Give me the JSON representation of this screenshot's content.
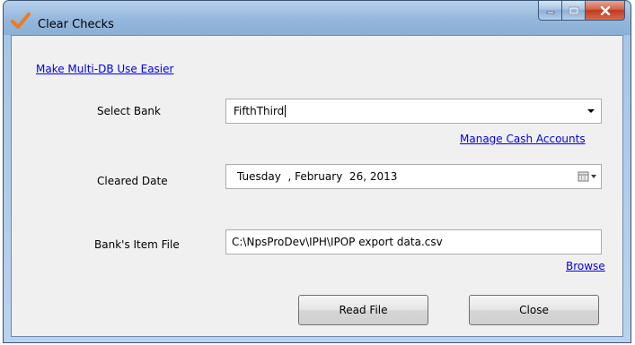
{
  "window": {
    "title": "Clear Checks",
    "buttons": {
      "minimize": "minimize",
      "maximize": "maximize",
      "close": "close"
    }
  },
  "links": {
    "multi_db": "Make Multi-DB Use Easier",
    "manage_cash": "Manage Cash Accounts",
    "browse": "Browse"
  },
  "form": {
    "bank": {
      "label": "Select Bank",
      "value": "FifthThird"
    },
    "cleared_date": {
      "label": "Cleared Date",
      "weekday": "Tuesday",
      "separator": ",",
      "date": "February  26, 2013"
    },
    "item_file": {
      "label": "Bank's Item  File",
      "value": "C:\\NpsProDev\\IPH\\IPOP export data.csv"
    }
  },
  "actions": {
    "read_file": "Read File",
    "close": "Close"
  },
  "icons": {
    "app": "checkmark-icon",
    "dropdown": "chevron-down-icon",
    "calendar": "calendar-icon"
  },
  "colors": {
    "link": "#0000ee",
    "title_bar": "#95b7dc",
    "close_button": "#c13a1f"
  }
}
